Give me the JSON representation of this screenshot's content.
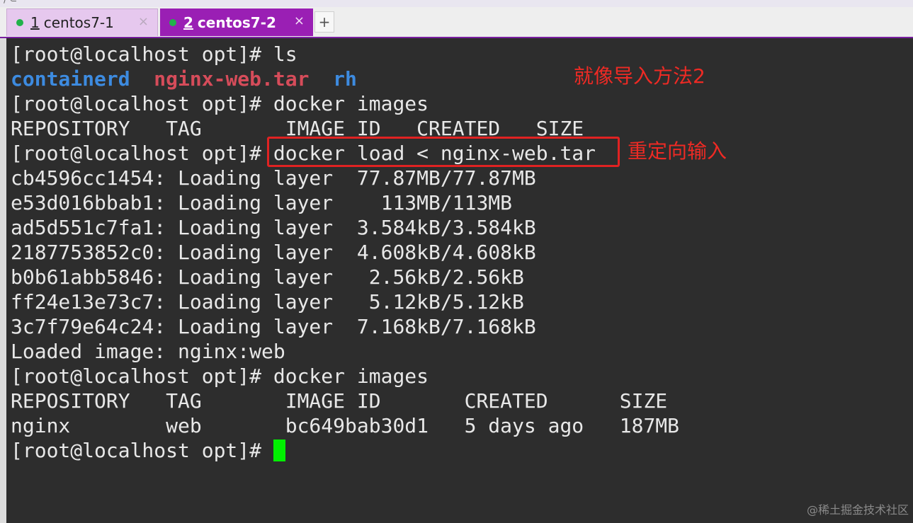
{
  "top_strip_text": "⟩ ⊂ ·· ·· · ··· ·· ·· · ·· · ···",
  "tabs": [
    {
      "number": "1",
      "title": "centos7-1",
      "close": "×"
    },
    {
      "number": "2",
      "title": "centos7-2",
      "close": "×"
    }
  ],
  "add_tab_label": "+",
  "terminal": {
    "line1": "[root@localhost opt]# ls",
    "ls_items": [
      "containerd",
      "nginx-web.tar",
      "rh"
    ],
    "line3": "[root@localhost opt]# docker images",
    "line4": "REPOSITORY   TAG       IMAGE ID   CREATED   SIZE",
    "line5_prompt": "[root@localhost opt]# ",
    "line5_cmd": "docker load < nginx-web.tar",
    "layers": [
      "cb4596cc1454: Loading layer  77.87MB/77.87MB",
      "e53d016bbab1: Loading layer    113MB/113MB",
      "ad5d551c7fa1: Loading layer  3.584kB/3.584kB",
      "2187753852c0: Loading layer  4.608kB/4.608kB",
      "b0b61abb5846: Loading layer   2.56kB/2.56kB",
      "ff24e13e73c7: Loading layer   5.12kB/5.12kB",
      "3c7f79e64c24: Loading layer  7.168kB/7.168kB"
    ],
    "loaded_line": "Loaded image: nginx:web",
    "line14": "[root@localhost opt]# docker images",
    "line15": "REPOSITORY   TAG       IMAGE ID       CREATED      SIZE",
    "line16": "nginx        web       bc649bab30d1   5 days ago   187MB",
    "line17_prompt": "[root@localhost opt]# "
  },
  "annotations": {
    "note1": "就像导入方法2",
    "note2": "重定向输入"
  },
  "watermark": "@稀土掘金技术社区",
  "colors": {
    "terminal_bg": "#2d2d2d",
    "active_tab": "#9a1fb4",
    "cursor": "#00f000",
    "annotation_red": "#ee2a24",
    "dir_blue": "#3d8be0",
    "archive_red": "#d64c5a"
  }
}
